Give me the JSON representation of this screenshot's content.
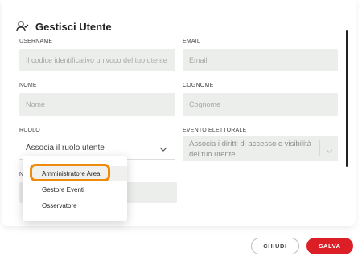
{
  "dialog": {
    "title": "Gestisci Utente",
    "icon": "user-edit-icon"
  },
  "form": {
    "username": {
      "label": "USERNAME",
      "placeholder": "Il codice identificativo univoco del tuo utente",
      "value": ""
    },
    "email": {
      "label": "EMAIL",
      "placeholder": "Email",
      "value": ""
    },
    "nome": {
      "label": "NOME",
      "placeholder": "Nome",
      "value": ""
    },
    "cognome": {
      "label": "COGNOME",
      "placeholder": "Cognome",
      "value": ""
    },
    "ruolo": {
      "label": "RUOLO",
      "value": "Associa il ruolo utente"
    },
    "evento": {
      "label": "EVENTO ELETTORALE",
      "value": "Associa i diritti di accesso e visibilità del tuo utente"
    },
    "hidden_label": "N"
  },
  "dropdown": {
    "options": [
      "Amministratore Area",
      "Gestore Eventi",
      "Osservatore"
    ],
    "highlighted_index": 0,
    "highlight_color": "#f08a0a"
  },
  "actions": {
    "cancel_label": "CHIUDI",
    "save_label": "SALVA",
    "save_color": "#dc1f26"
  }
}
